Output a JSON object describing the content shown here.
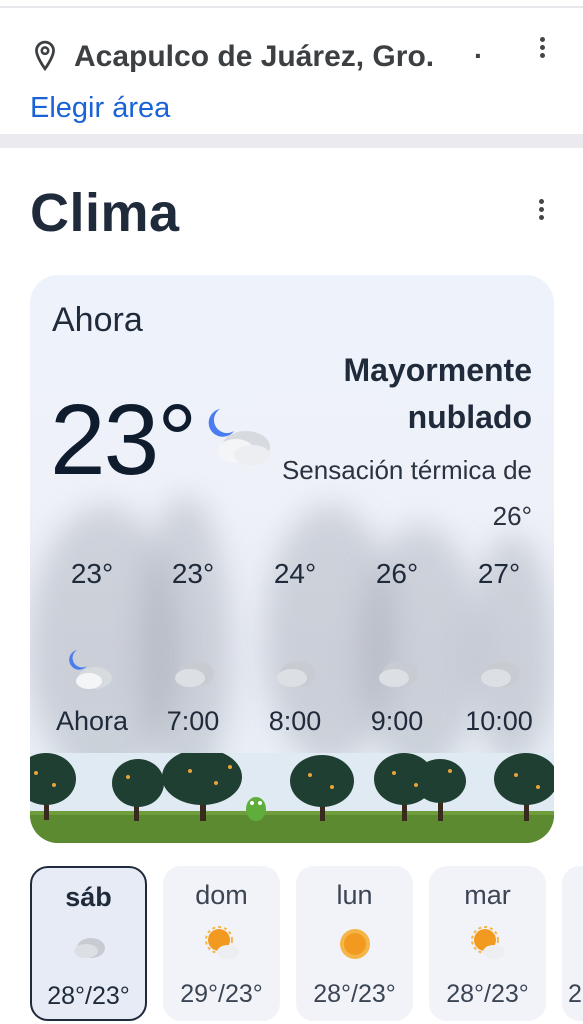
{
  "location": {
    "name": "Acapulco de Juárez, Gro.",
    "dot": "·",
    "choose_area": "Elegir área",
    "icon": "map-pin-icon"
  },
  "weather": {
    "title": "Clima",
    "now_label": "Ahora",
    "temperature": "23°",
    "condition": "Mayormente nublado",
    "feels_like": "Sensación térmica de 26°",
    "current_icon": "moon-cloud-icon",
    "hourly": [
      {
        "temp": "23°",
        "time": "Ahora",
        "icon": "moon-cloud-icon"
      },
      {
        "temp": "23°",
        "time": "7:00",
        "icon": "cloud-icon"
      },
      {
        "temp": "24°",
        "time": "8:00",
        "icon": "cloud-icon"
      },
      {
        "temp": "26°",
        "time": "9:00",
        "icon": "cloud-icon"
      },
      {
        "temp": "27°",
        "time": "10:00",
        "icon": "cloud-icon"
      }
    ],
    "daily": [
      {
        "day": "sáb",
        "range": "28°/23°",
        "icon": "cloud-icon",
        "selected": true
      },
      {
        "day": "dom",
        "range": "29°/23°",
        "icon": "sun-cloud-icon"
      },
      {
        "day": "lun",
        "range": "28°/23°",
        "icon": "sun-icon"
      },
      {
        "day": "mar",
        "range": "28°/23°",
        "icon": "sun-cloud-icon"
      },
      {
        "day": "",
        "range": "2",
        "icon": ""
      }
    ]
  },
  "colors": {
    "accent_link": "#1a62d6",
    "title_text": "#1f2a3a",
    "card_bg": "#eef2fb",
    "moon": "#4a7df0",
    "sun": "#f29a1f"
  }
}
